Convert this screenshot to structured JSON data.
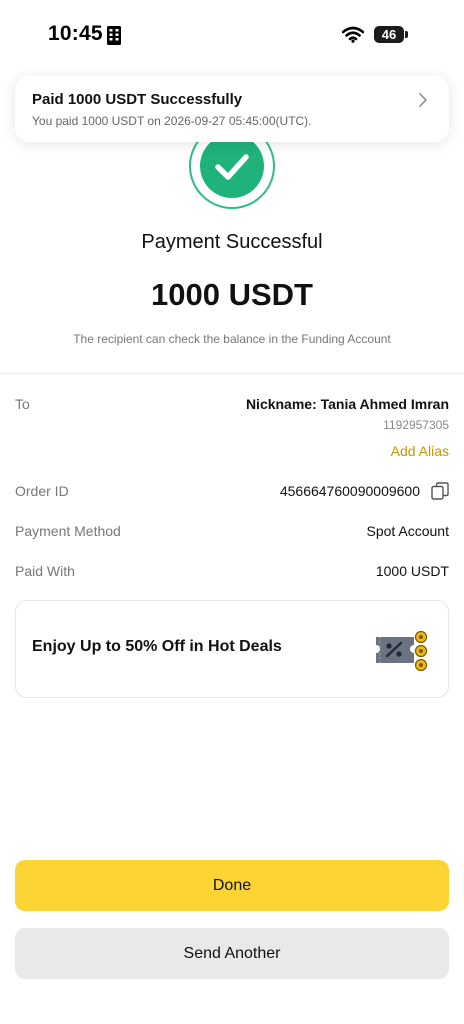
{
  "status_bar": {
    "time": "10:45",
    "battery": "46"
  },
  "notification": {
    "title": "Paid 1000 USDT Successfully",
    "subtitle": "You paid 1000 USDT on 2026-09-27 05:45:00(UTC)."
  },
  "payment": {
    "title": "Payment Successful",
    "amount": "1000 USDT",
    "note": "The recipient can check the balance in the Funding Account"
  },
  "details": {
    "to_label": "To",
    "nickname": "Nickname: Tania Ahmed Imran",
    "uid": "1192957305",
    "add_alias": "Add Alias",
    "order_id_label": "Order ID",
    "order_id": "456664760090009600",
    "payment_method_label": "Payment Method",
    "payment_method": "Spot Account",
    "paid_with_label": "Paid With",
    "paid_with": "1000 USDT"
  },
  "promo": {
    "text": "Enjoy Up to 50% Off in Hot Deals"
  },
  "actions": {
    "done": "Done",
    "send_another": "Send Another"
  },
  "colors": {
    "accent_yellow": "#fcd535",
    "success_green": "#20b27b",
    "alias_gold": "#c99400"
  },
  "icons": [
    "building-icon",
    "wifi-icon",
    "battery-icon",
    "chevron-right-icon",
    "checkmark-icon",
    "copy-icon",
    "coupon-icon"
  ]
}
